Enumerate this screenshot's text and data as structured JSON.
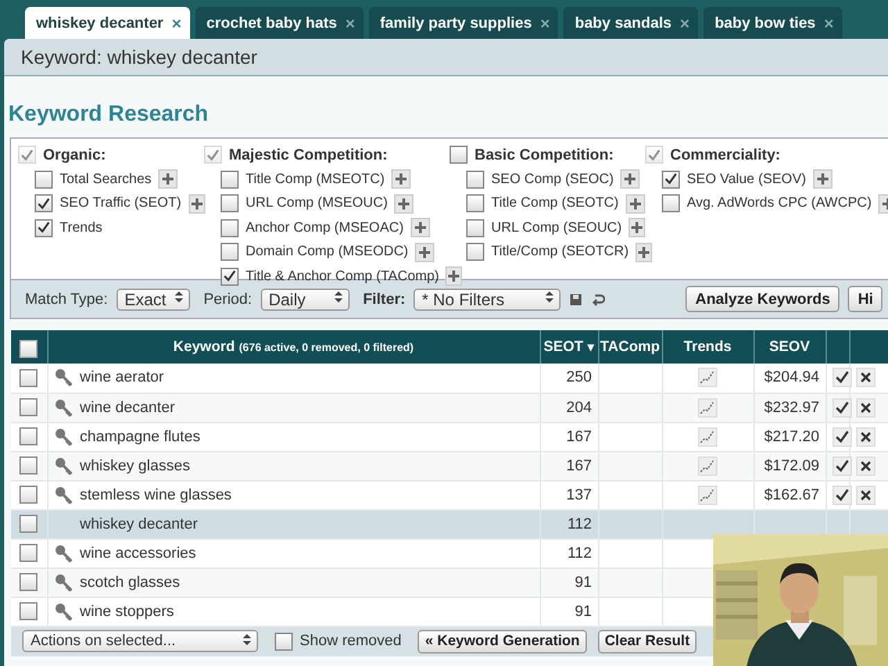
{
  "tabs": [
    {
      "label": "whiskey decanter",
      "selected": true,
      "close": "×"
    },
    {
      "label": "crochet baby hats",
      "selected": false,
      "close": "×"
    },
    {
      "label": "family party supplies",
      "selected": false,
      "close": "×"
    },
    {
      "label": "baby sandals",
      "selected": false,
      "close": "×"
    },
    {
      "label": "baby bow ties",
      "selected": false,
      "close": "×"
    }
  ],
  "keyword_header": "Keyword: whiskey decanter",
  "section_title": "Keyword Research",
  "option_groups": [
    {
      "label": "Organic:",
      "checked": true,
      "disabled": true,
      "options": [
        {
          "label": "Total Searches",
          "checked": false,
          "plus": true
        },
        {
          "label": "SEO Traffic (SEOT)",
          "checked": true,
          "plus": true
        },
        {
          "label": "Trends",
          "checked": true,
          "plus": false
        }
      ]
    },
    {
      "label": "Majestic Competition:",
      "checked": true,
      "disabled": true,
      "options": [
        {
          "label": "Title Comp (MSEOTC)",
          "checked": false,
          "plus": true
        },
        {
          "label": "URL Comp (MSEOUC)",
          "checked": false,
          "plus": true
        },
        {
          "label": "Anchor Comp (MSEOAC)",
          "checked": false,
          "plus": true
        },
        {
          "label": "Domain Comp (MSEODC)",
          "checked": false,
          "plus": true
        },
        {
          "label": "Title & Anchor Comp (TAComp)",
          "checked": true,
          "plus": true
        }
      ]
    },
    {
      "label": "Basic Competition:",
      "checked": false,
      "disabled": false,
      "options": [
        {
          "label": "SEO Comp (SEOC)",
          "checked": false,
          "plus": true
        },
        {
          "label": "Title Comp (SEOTC)",
          "checked": false,
          "plus": true
        },
        {
          "label": "URL Comp (SEOUC)",
          "checked": false,
          "plus": true
        },
        {
          "label": "Title/Comp (SEOTCR)",
          "checked": false,
          "plus": true
        }
      ]
    },
    {
      "label": "Commerciality:",
      "checked": true,
      "disabled": true,
      "options": [
        {
          "label": "SEO Value (SEOV)",
          "checked": true,
          "plus": true
        },
        {
          "label": "Avg. AdWords CPC (AWCPC)",
          "checked": false,
          "plus": true
        }
      ]
    }
  ],
  "toolbar": {
    "match_type_label": "Match Type:",
    "match_type": "Exact",
    "period_label": "Period:",
    "period": "Daily",
    "filter_label": "Filter:",
    "filter": "* No Filters",
    "buttons": [
      "Analyze Keywords",
      "Hi"
    ]
  },
  "table": {
    "columns": [
      {
        "label": "Keyword",
        "note": "(676 active, 0 removed, 0 filtered)"
      },
      {
        "label": "SEOT",
        "sort": "▾"
      },
      {
        "label": "TAComp"
      },
      {
        "label": "Trends"
      },
      {
        "label": "SEOV"
      }
    ],
    "select_all": {
      "checked": false
    },
    "rows": [
      {
        "kind": "keyword",
        "keyword": "wine aerator",
        "seot": "250",
        "seov": "$204.94",
        "trend": true,
        "actions": true,
        "selected": false,
        "checked": false
      },
      {
        "kind": "keyword",
        "keyword": "wine decanter",
        "seot": "204",
        "seov": "$232.97",
        "trend": true,
        "actions": true,
        "selected": false,
        "checked": false
      },
      {
        "kind": "keyword",
        "keyword": "champagne flutes",
        "seot": "167",
        "seov": "$217.20",
        "trend": true,
        "actions": true,
        "selected": false,
        "checked": false
      },
      {
        "kind": "keyword",
        "keyword": "whiskey glasses",
        "seot": "167",
        "seov": "$172.09",
        "trend": true,
        "actions": true,
        "selected": false,
        "checked": false
      },
      {
        "kind": "keyword",
        "keyword": "stemless wine glasses",
        "seot": "137",
        "seov": "$162.67",
        "trend": true,
        "actions": true,
        "selected": false,
        "checked": false
      },
      {
        "kind": "seed",
        "keyword": "whiskey decanter",
        "seot": "112",
        "trend": false,
        "actions": false,
        "selected": true,
        "checked": false
      },
      {
        "kind": "keyword",
        "keyword": "wine accessories",
        "seot": "112",
        "trend": false,
        "actions": false,
        "selected": false,
        "checked": false
      },
      {
        "kind": "keyword",
        "keyword": "scotch glasses",
        "seot": "91",
        "trend": false,
        "actions": false,
        "selected": false,
        "checked": false
      },
      {
        "kind": "keyword",
        "keyword": "wine stoppers",
        "seot": "91",
        "trend": false,
        "actions": false,
        "selected": false,
        "checked": false
      }
    ]
  },
  "footer": {
    "actions": "Actions on selected...",
    "show_removed": {
      "label": "Show removed",
      "checked": false
    },
    "buttons": [
      "« Keyword Generation",
      "Clear Result"
    ]
  }
}
